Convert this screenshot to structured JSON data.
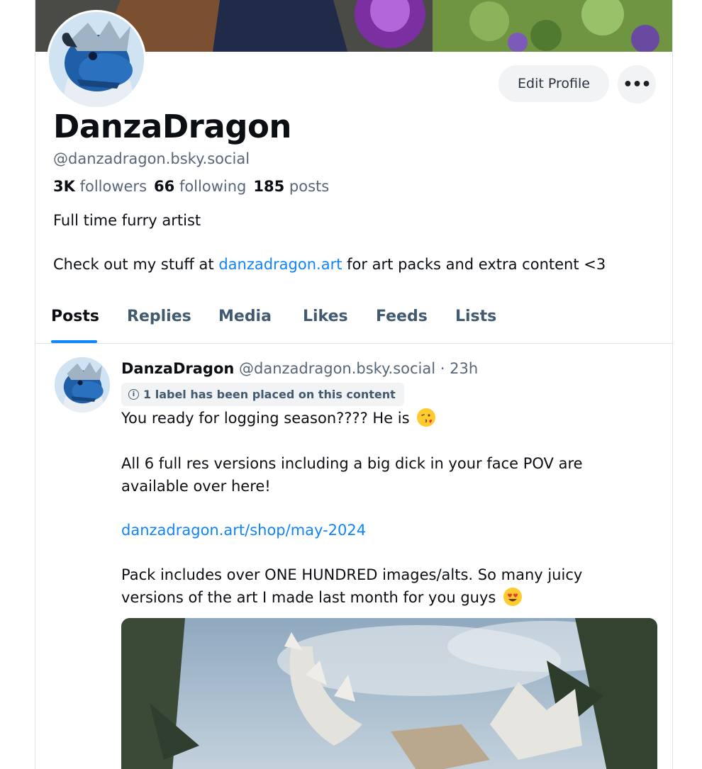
{
  "profile": {
    "display_name": "DanzaDragon",
    "handle": "@danzadragon.bsky.social",
    "followers_count": "3K",
    "followers_label": "followers",
    "following_count": "66",
    "following_label": "following",
    "posts_count": "185",
    "posts_label": "posts",
    "bio_line1": "Full time furry artist",
    "bio_line2_pre": "Check out my stuff at ",
    "bio_link": "danzadragon.art",
    "bio_line2_post": " for art packs and extra content <3"
  },
  "actions": {
    "edit_profile": "Edit Profile",
    "more": "•••"
  },
  "tabs": [
    {
      "label": "Posts",
      "active": true
    },
    {
      "label": "Replies",
      "active": false
    },
    {
      "label": "Media",
      "active": false
    },
    {
      "label": "Likes",
      "active": false
    },
    {
      "label": "Feeds",
      "active": false
    },
    {
      "label": "Lists",
      "active": false
    }
  ],
  "post": {
    "author_name": "DanzaDragon",
    "author_handle": "@danzadragon.bsky.social",
    "separator": " · ",
    "time": "23h",
    "label_notice": "1 label has been placed on this content",
    "line1": "You ready for logging season???? He is",
    "line2": "All 6 full res versions including a big dick in your face POV are",
    "line3": "available over here!",
    "link": "danzadragon.art/shop/may-2024",
    "line4": "Pack includes over ONE HUNDRED images/alts. So many juicy",
    "line5": "versions of the art I made last month for you guys"
  },
  "icons": {
    "info": "info-circle-icon",
    "emoji1": "kissing-face-emoji",
    "emoji2": "heart-eyes-emoji"
  },
  "colors": {
    "accent": "#1083fe",
    "muted_text": "#58667a",
    "pill_bg": "#f1f3f5"
  }
}
